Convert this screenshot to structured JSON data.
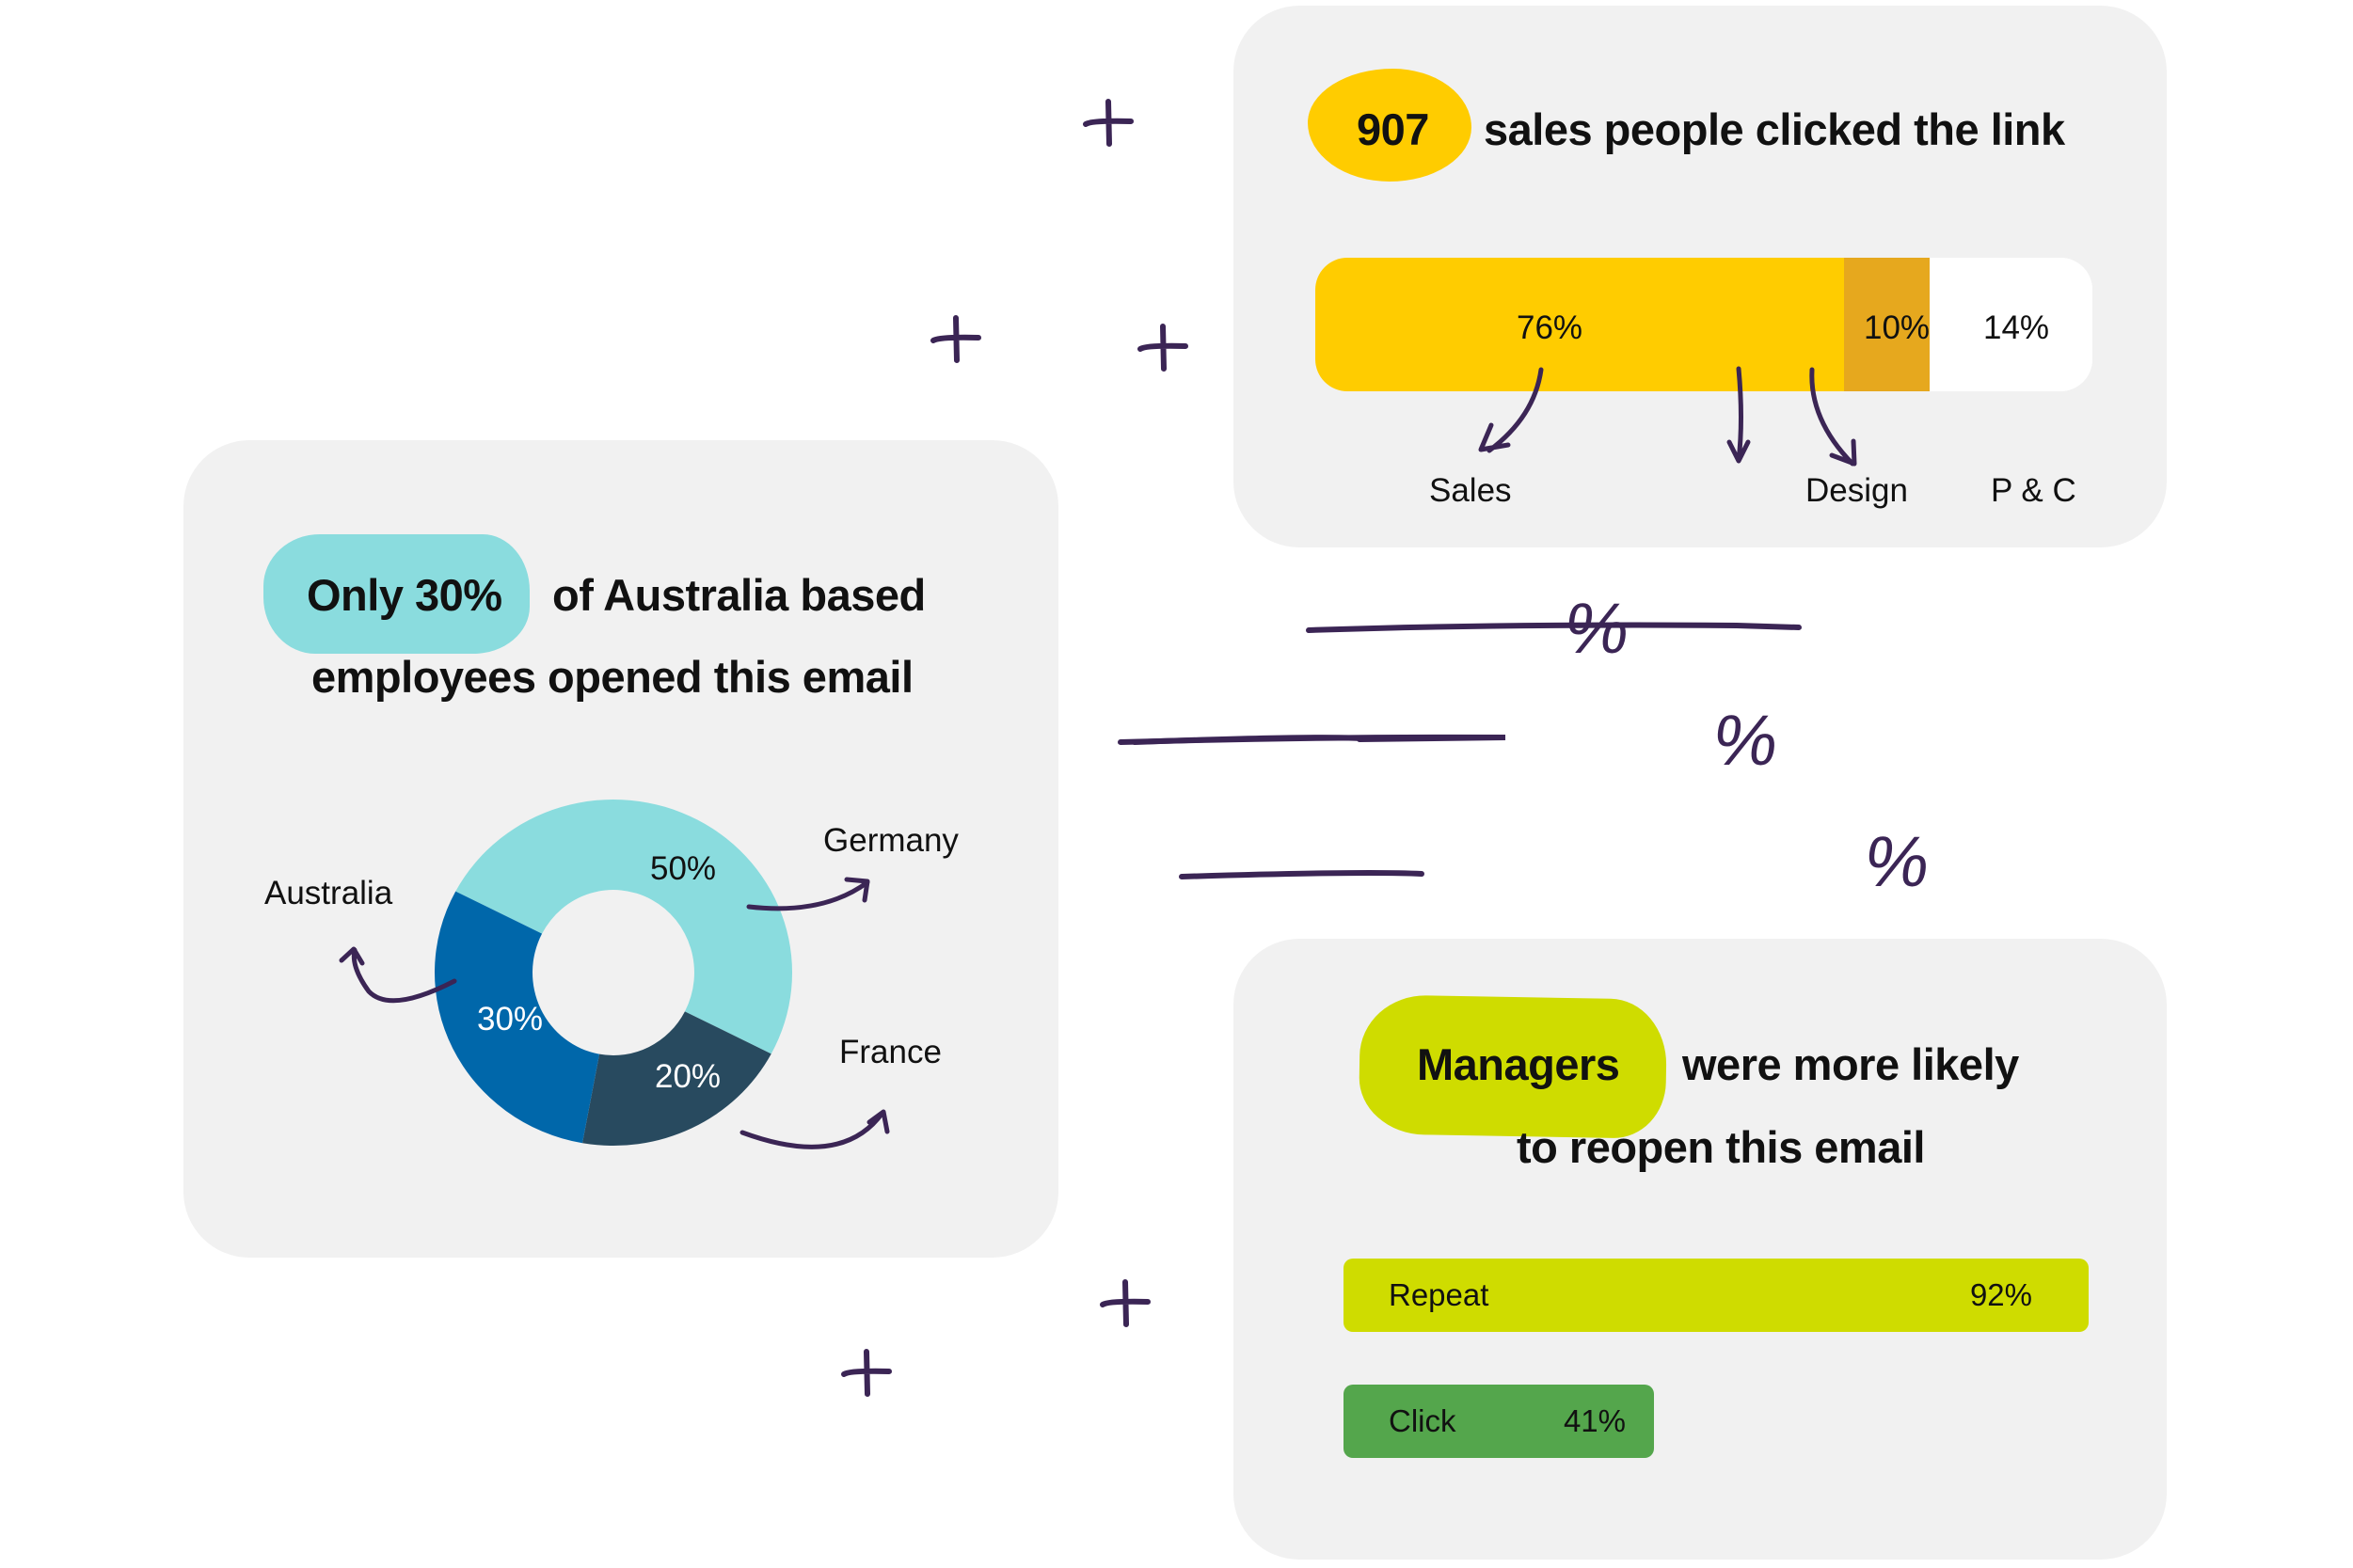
{
  "colors": {
    "card_bg": "#f1f1f1",
    "yellow": "#ffcc00",
    "amber": "#e6a81e",
    "teal_light": "#8adcde",
    "blue": "#0067aa",
    "navy": "#284a5f",
    "lime": "#cfdc00",
    "green": "#54a64c",
    "ink": "#3b2555"
  },
  "card_clicks": {
    "highlight": "907",
    "headline_rest": "sales people clicked the link"
  },
  "card_opens": {
    "highlight": "Only 30%",
    "headline_line1_rest": "of Australia based",
    "headline_line2": "employees opened this email"
  },
  "card_reopen": {
    "highlight": "Managers",
    "headline_line1_rest": "were more likely",
    "headline_line2": "to reopen this email"
  },
  "decorations": {
    "percent_sign": "%",
    "plus_icon_count": 6,
    "line_count": 3
  },
  "chart_data": [
    {
      "type": "bar",
      "subtype": "stacked-horizontal",
      "title": "907 sales people clicked the link",
      "categories": [
        "Sales",
        "Design",
        "P & C"
      ],
      "values": [
        76,
        10,
        14
      ],
      "value_labels": [
        "76%",
        "10%",
        "14%"
      ],
      "colors": [
        "#ffcc00",
        "#e6a81e",
        "#ffffff"
      ],
      "unit": "%"
    },
    {
      "type": "pie",
      "subtype": "donut",
      "title": "Only 30% of Australia based employees opened this email",
      "categories": [
        "Germany",
        "France",
        "Australia"
      ],
      "values": [
        50,
        20,
        30
      ],
      "value_labels": [
        "50%",
        "20%",
        "30%"
      ],
      "colors": [
        "#8adcde",
        "#284a5f",
        "#0067aa"
      ],
      "label_colors": [
        "#111111",
        "#ffffff",
        "#ffffff"
      ],
      "unit": "%"
    },
    {
      "type": "bar",
      "subtype": "horizontal",
      "title": "Managers were more likely to reopen this email",
      "categories": [
        "Repeat",
        "Click"
      ],
      "values": [
        92,
        41
      ],
      "value_labels": [
        "92%",
        "41%"
      ],
      "colors": [
        "#cfdc00",
        "#54a64c"
      ],
      "xlim": [
        0,
        100
      ],
      "unit": "%"
    }
  ]
}
